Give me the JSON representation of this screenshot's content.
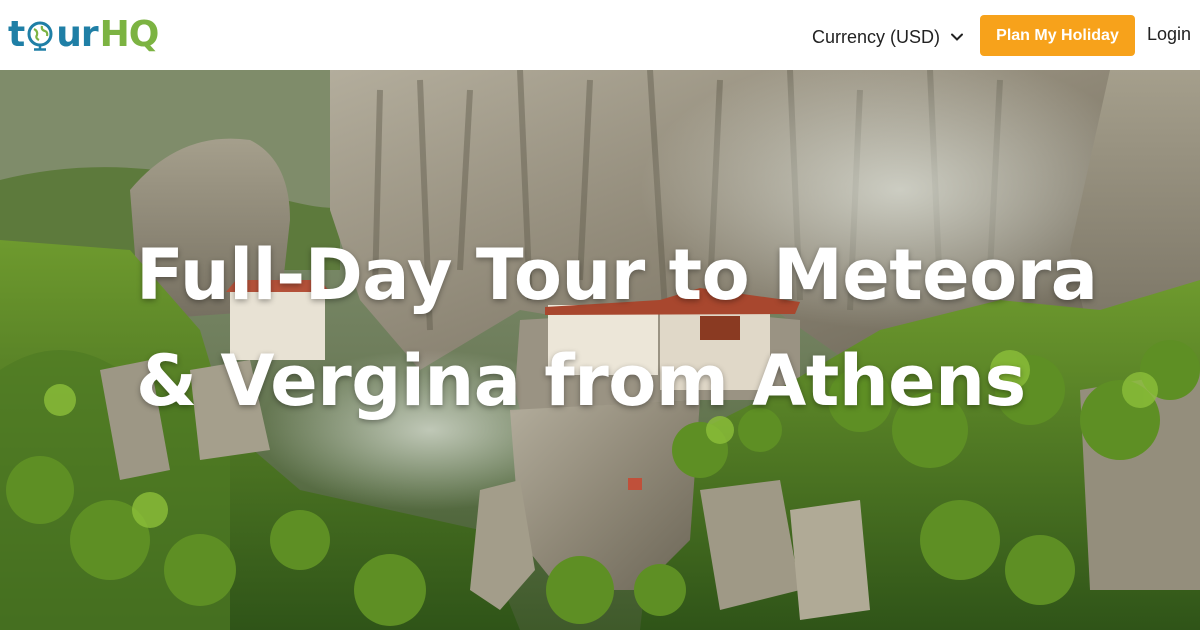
{
  "header": {
    "logo": {
      "part1": "t",
      "part2": "ur",
      "part3": "HQ"
    },
    "currency_label": "Currency (USD)",
    "plan_button": "Plan My Holiday",
    "login": "Login"
  },
  "hero": {
    "title": "Full-Day Tour to Meteora & Vergina from Athens"
  },
  "colors": {
    "brand_blue": "#1f7fa6",
    "brand_green": "#7cb342",
    "accent_orange": "#f7a21b"
  },
  "icons": {
    "logo_globe": "globe-icon",
    "currency_dropdown": "chevron-down-icon"
  }
}
